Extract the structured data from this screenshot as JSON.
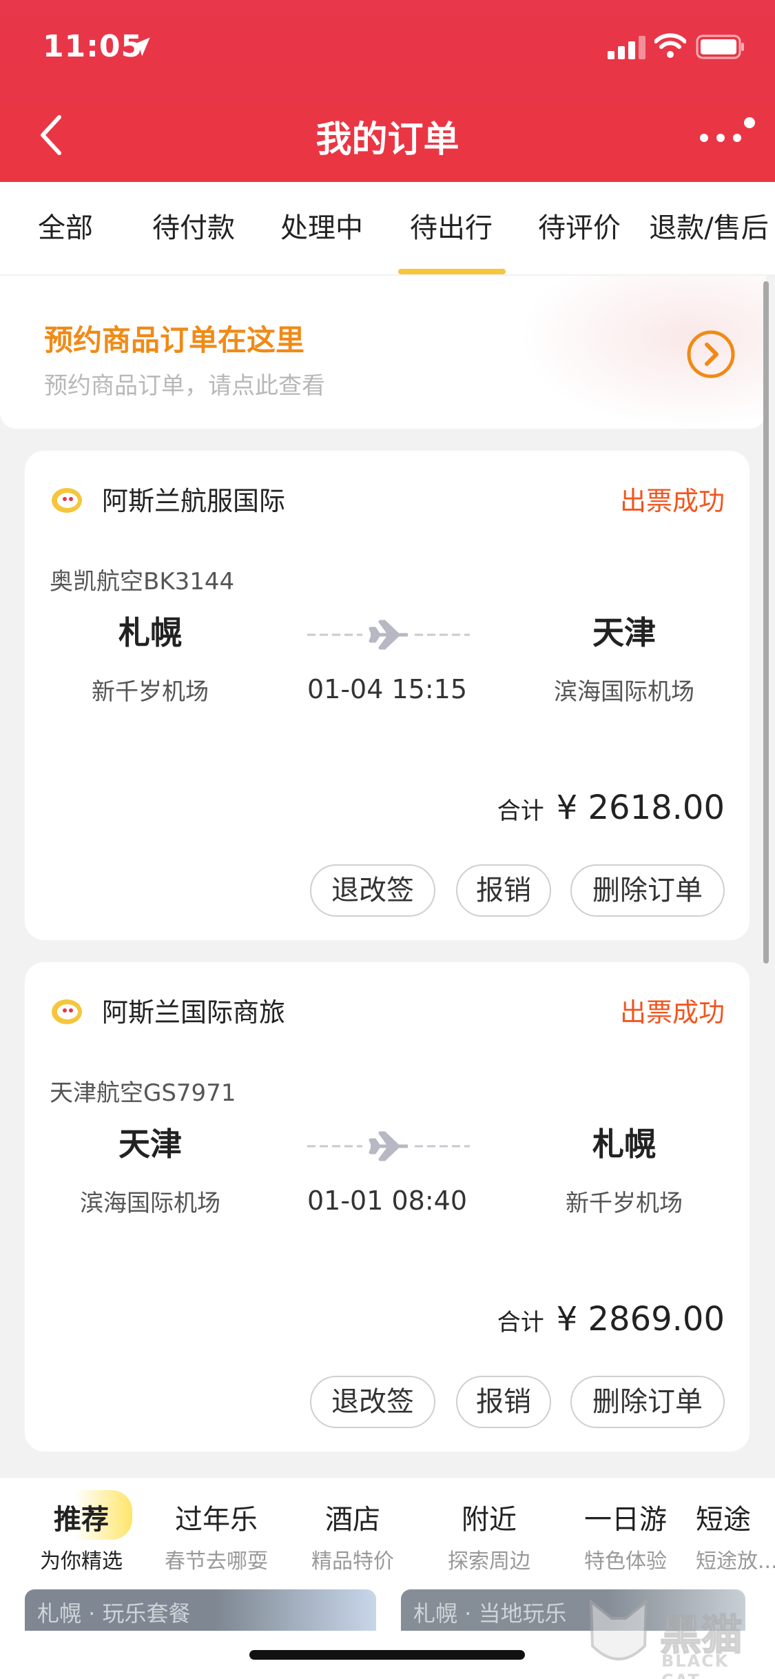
{
  "status_bar": {
    "time": "11:05"
  },
  "header": {
    "title": "我的订单"
  },
  "tabs": [
    {
      "label": "全部"
    },
    {
      "label": "待付款"
    },
    {
      "label": "处理中"
    },
    {
      "label": "待出行"
    },
    {
      "label": "待评价"
    },
    {
      "label": "退款/售后"
    }
  ],
  "active_tab": "待出行",
  "promo": {
    "title": "预约商品订单在这里",
    "subtitle": "预约商品订单，请点此查看"
  },
  "orders": [
    {
      "agency": "阿斯兰航服国际",
      "status": "出票成功",
      "flight": "奥凯航空BK3144",
      "dep_city": "札幌",
      "dep_airport": "新千岁机场",
      "arr_city": "天津",
      "arr_airport": "滨海国际机场",
      "datetime": "01-04 15:15",
      "total_label": "合计",
      "total": "¥ 2618.00",
      "buttons": {
        "refund": "退改签",
        "receipt": "报销",
        "delete": "删除订单"
      }
    },
    {
      "agency": "阿斯兰国际商旅",
      "status": "出票成功",
      "flight": "天津航空GS7971",
      "dep_city": "天津",
      "dep_airport": "滨海国际机场",
      "arr_city": "札幌",
      "arr_airport": "新千岁机场",
      "datetime": "01-01 08:40",
      "total_label": "合计",
      "total": "¥ 2869.00",
      "buttons": {
        "refund": "退改签",
        "receipt": "报销",
        "delete": "删除订单"
      }
    }
  ],
  "recommend_tabs": [
    {
      "title": "推荐",
      "sub": "为你精选"
    },
    {
      "title": "过年乐",
      "sub": "春节去哪耍"
    },
    {
      "title": "酒店",
      "sub": "精品特价"
    },
    {
      "title": "附近",
      "sub": "探索周边"
    },
    {
      "title": "一日游",
      "sub": "特色体验"
    },
    {
      "title": "短途",
      "sub": "短途放..."
    }
  ],
  "recommend_thumbs": [
    {
      "text": "札幌 · 玩乐套餐"
    },
    {
      "text": "札幌 · 当地玩乐"
    }
  ],
  "watermark": {
    "title": "黑猫",
    "sub": "BLACK CAT"
  },
  "colors": {
    "header": "#ea3642",
    "status_orange": "#f2551f",
    "promo_orange": "#f08a16",
    "tab_underline": "#f5c53c"
  },
  "icons": [
    "location-arrow-icon",
    "signal-icon",
    "wifi-icon",
    "battery-icon",
    "back-chevron-icon",
    "more-dots-icon",
    "chevron-right-circle-icon",
    "agency-logo-icon",
    "plane-icon"
  ]
}
